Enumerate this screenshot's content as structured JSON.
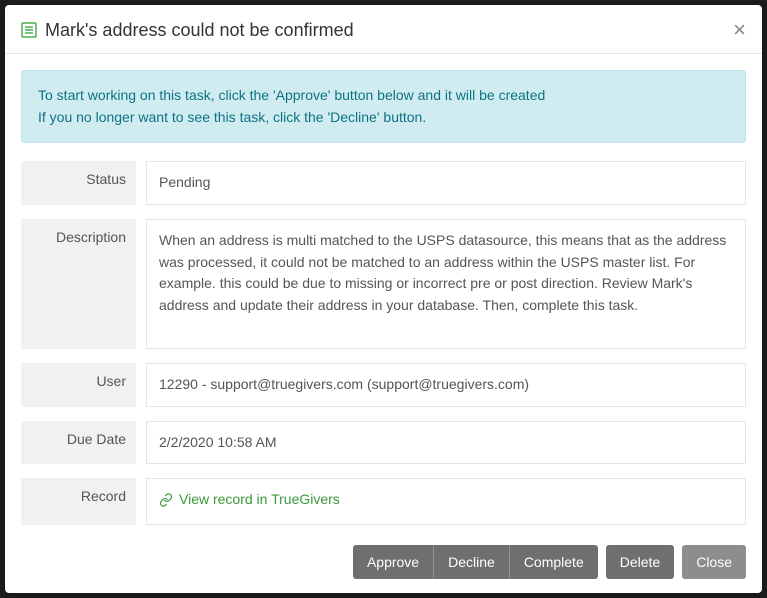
{
  "header": {
    "title": "Mark's address could not be confirmed"
  },
  "alert": {
    "line1": "To start working on this task, click the 'Approve' button below and it will be created",
    "line2": "If you no longer want to see this task, click the 'Decline' button."
  },
  "fields": {
    "status": {
      "label": "Status",
      "value": "Pending"
    },
    "description": {
      "label": "Description",
      "value": "When an address is multi matched to the USPS datasource, this means that as the address was processed, it could not be matched to an address within the USPS master list. For example. this could be due to missing or incorrect pre or post direction. Review Mark's address and update their address in your database. Then, complete this task."
    },
    "user": {
      "label": "User",
      "value": "12290 - support@truegivers.com (support@truegivers.com)"
    },
    "dueDate": {
      "label": "Due Date",
      "value": "2/2/2020 10:58 AM"
    },
    "record": {
      "label": "Record",
      "linkText": "View record in TrueGivers"
    }
  },
  "buttons": {
    "approve": "Approve",
    "decline": "Decline",
    "complete": "Complete",
    "delete": "Delete",
    "close": "Close"
  }
}
